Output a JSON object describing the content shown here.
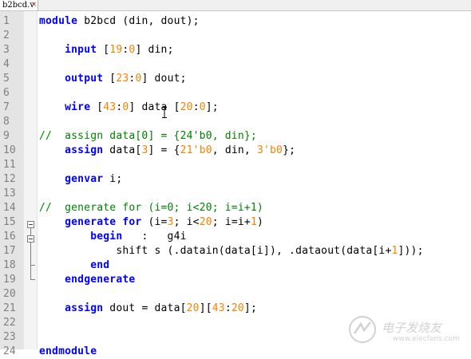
{
  "tab": {
    "filename": "b2bcd.v",
    "close": "×"
  },
  "lines": [
    {
      "n": "1",
      "segs": [
        [
          "kw",
          "module"
        ],
        [
          "t",
          " b2bcd (din, dout);"
        ]
      ]
    },
    {
      "n": "2",
      "segs": []
    },
    {
      "n": "3",
      "segs": [
        [
          "t",
          "    "
        ],
        [
          "kw",
          "input"
        ],
        [
          "t",
          " ["
        ],
        [
          "num",
          "19"
        ],
        [
          "t",
          ":"
        ],
        [
          "num",
          "0"
        ],
        [
          "t",
          "] din;"
        ]
      ]
    },
    {
      "n": "4",
      "segs": []
    },
    {
      "n": "5",
      "segs": [
        [
          "t",
          "    "
        ],
        [
          "kw",
          "output"
        ],
        [
          "t",
          " ["
        ],
        [
          "num",
          "23"
        ],
        [
          "t",
          ":"
        ],
        [
          "num",
          "0"
        ],
        [
          "t",
          "] dout;"
        ]
      ]
    },
    {
      "n": "6",
      "segs": []
    },
    {
      "n": "7",
      "segs": [
        [
          "t",
          "    "
        ],
        [
          "kw",
          "wire"
        ],
        [
          "t",
          " ["
        ],
        [
          "num",
          "43"
        ],
        [
          "t",
          ":"
        ],
        [
          "num",
          "0"
        ],
        [
          "t",
          "] data ["
        ],
        [
          "num",
          "20"
        ],
        [
          "t",
          ":"
        ],
        [
          "num",
          "0"
        ],
        [
          "t",
          "];"
        ]
      ]
    },
    {
      "n": "8",
      "segs": []
    },
    {
      "n": "9",
      "segs": [
        [
          "cmt",
          "//  assign data[0] = {24'b0, din};"
        ]
      ]
    },
    {
      "n": "10",
      "segs": [
        [
          "t",
          "    "
        ],
        [
          "kw",
          "assign"
        ],
        [
          "t",
          " data["
        ],
        [
          "num",
          "3"
        ],
        [
          "t",
          "] = {"
        ],
        [
          "num",
          "21'b0"
        ],
        [
          "t",
          ", din, "
        ],
        [
          "num",
          "3'b0"
        ],
        [
          "t",
          "};"
        ]
      ]
    },
    {
      "n": "11",
      "segs": []
    },
    {
      "n": "12",
      "segs": [
        [
          "t",
          "    "
        ],
        [
          "kw",
          "genvar"
        ],
        [
          "t",
          " i;"
        ]
      ]
    },
    {
      "n": "13",
      "segs": []
    },
    {
      "n": "14",
      "segs": [
        [
          "cmt",
          "//  generate for (i=0; i<20; i=i+1)"
        ]
      ]
    },
    {
      "n": "15",
      "segs": [
        [
          "t",
          "    "
        ],
        [
          "kw",
          "generate"
        ],
        [
          "t",
          " "
        ],
        [
          "kw",
          "for"
        ],
        [
          "t",
          " (i="
        ],
        [
          "num",
          "3"
        ],
        [
          "t",
          "; i<"
        ],
        [
          "num",
          "20"
        ],
        [
          "t",
          "; i=i+"
        ],
        [
          "num",
          "1"
        ],
        [
          "t",
          ")"
        ]
      ]
    },
    {
      "n": "16",
      "segs": [
        [
          "t",
          "        "
        ],
        [
          "kw",
          "begin"
        ],
        [
          "t",
          "   :   g4i"
        ]
      ]
    },
    {
      "n": "17",
      "segs": [
        [
          "t",
          "            shift s (.datain(data[i]), .dataout(data[i+"
        ],
        [
          "num",
          "1"
        ],
        [
          "t",
          "]));"
        ]
      ]
    },
    {
      "n": "18",
      "segs": [
        [
          "t",
          "        "
        ],
        [
          "kw",
          "end"
        ]
      ]
    },
    {
      "n": "19",
      "segs": [
        [
          "t",
          "    "
        ],
        [
          "kw",
          "endgenerate"
        ]
      ]
    },
    {
      "n": "20",
      "segs": []
    },
    {
      "n": "21",
      "segs": [
        [
          "t",
          "    "
        ],
        [
          "kw",
          "assign"
        ],
        [
          "t",
          " dout = data["
        ],
        [
          "num",
          "20"
        ],
        [
          "t",
          "]["
        ],
        [
          "num",
          "43"
        ],
        [
          "t",
          ":"
        ],
        [
          "num",
          "20"
        ],
        [
          "t",
          "];"
        ]
      ]
    },
    {
      "n": "22",
      "segs": []
    },
    {
      "n": "23",
      "segs": []
    },
    {
      "n": "24",
      "segs": [
        [
          "kw",
          "endmodule"
        ]
      ]
    }
  ],
  "watermark": {
    "text": "电子发烧友",
    "url": "www.elecfans.com"
  },
  "colors": {
    "keyword": "#0000ff",
    "number": "#ff8000",
    "comment": "#008000",
    "gutter": "#e4e4e4"
  }
}
